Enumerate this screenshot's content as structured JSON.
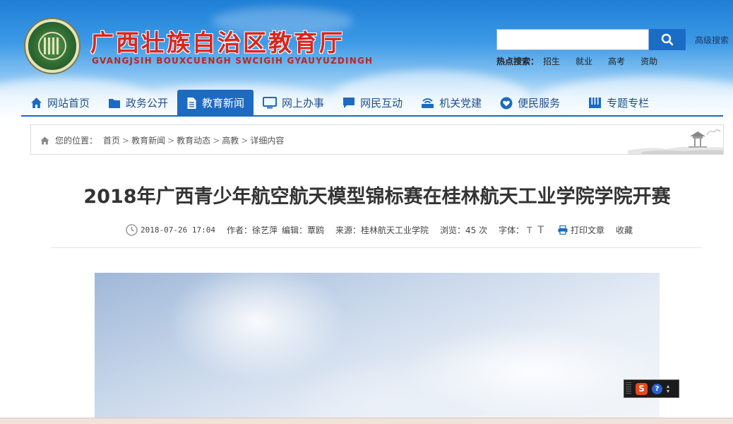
{
  "header": {
    "title": "广西壮族自治区教育厅",
    "subtitle": "GVANGJSIH BOUXCUENGH SWCIGIH GYAUYUZDINGH",
    "search": {
      "value": "",
      "button_icon": "search-icon"
    },
    "advanced_search": "高级搜索",
    "hot_label": "热点搜索：",
    "hot_terms": [
      "招生",
      "就业",
      "高考",
      "资助"
    ]
  },
  "nav": {
    "items": [
      {
        "label": "网站首页",
        "icon": "home-icon"
      },
      {
        "label": "政务公开",
        "icon": "folder-icon"
      },
      {
        "label": "教育新闻",
        "icon": "document-icon",
        "active": true
      },
      {
        "label": "网上办事",
        "icon": "monitor-icon"
      },
      {
        "label": "网民互动",
        "icon": "chat-icon"
      },
      {
        "label": "机关党建",
        "icon": "router-icon"
      },
      {
        "label": "便民服务",
        "icon": "heart-icon"
      },
      {
        "label": "专题专栏",
        "icon": "columns-icon"
      }
    ]
  },
  "breadcrumb": {
    "label": "您的位置：",
    "items": [
      "首页",
      "教育新闻",
      "教育动态",
      "高教",
      "详细内容"
    ],
    "separator": ">"
  },
  "article": {
    "title": "2018年广西青少年航空航天模型锦标赛在桂林航天工业学院学院开赛",
    "date": "2018-07-26 17:04",
    "author": "作者：徐艺萍",
    "editor": "编辑：覃鸥",
    "source": "来源：桂林航天工业学院",
    "views": "浏览：45 次",
    "font_label": "字体：",
    "font_small": "T",
    "font_large": "T",
    "print": "打印文章",
    "favorite": "收藏"
  },
  "ime": {
    "logo": "S",
    "help": "?"
  },
  "colors": {
    "title_red": "#d7261e",
    "nav_blue": "#1c6ac2",
    "nav_text": "#1e4f8c"
  }
}
